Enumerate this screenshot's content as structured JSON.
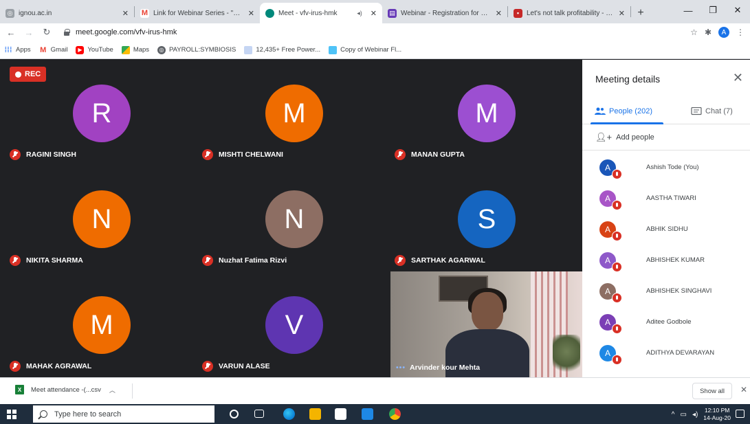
{
  "browser": {
    "tabs": [
      {
        "title": "ignou.ac.in",
        "favicon": "globe-icon",
        "active": false
      },
      {
        "title": "Link for Webinar Series - \"Can",
        "favicon": "gmail-icon",
        "active": false
      },
      {
        "title": "Meet - vfv-irus-hmk",
        "favicon": "meet-icon",
        "active": true
      },
      {
        "title": "Webinar - Registration for Gue",
        "favicon": "forms-icon",
        "active": false
      },
      {
        "title": "Let's not talk profitability - Ch",
        "favicon": "video-icon",
        "active": false
      }
    ],
    "url": "meet.google.com/vfv-irus-hmk",
    "profile_initial": "A",
    "bookmarks": [
      {
        "label": "Apps",
        "icon": "apps-grid-icon",
        "color": "#4285f4"
      },
      {
        "label": "Gmail",
        "icon": "gmail-icon",
        "color": "#ea4335"
      },
      {
        "label": "YouTube",
        "icon": "youtube-icon",
        "color": "#ff0000"
      },
      {
        "label": "Maps",
        "icon": "maps-icon",
        "color": "#34a853"
      },
      {
        "label": "PAYROLL:SYMBIOSIS",
        "icon": "globe-icon",
        "color": "#5f6368"
      },
      {
        "label": "12,435+ Free Power...",
        "icon": "page-icon",
        "color": "#8ab4f8"
      },
      {
        "label": "Copy of Webinar Fl...",
        "icon": "page-icon",
        "color": "#4fc3f7"
      }
    ]
  },
  "meet": {
    "rec_label": "REC",
    "tiles": [
      {
        "initial": "R",
        "name": "RAGINI SINGH",
        "color": "#a142c2"
      },
      {
        "initial": "M",
        "name": "MISHTI CHELWANI",
        "color": "#ef6c00"
      },
      {
        "initial": "M",
        "name": "MANAN GUPTA",
        "color": "#9c4fd1"
      },
      {
        "initial": "N",
        "name": "NIKITA SHARMA",
        "color": "#ef6c00"
      },
      {
        "initial": "N",
        "name": "Nuzhat Fatima Rizvi",
        "color": "#8d6e63"
      },
      {
        "initial": "S",
        "name": "SARTHAK AGARWAL",
        "color": "#1565c0"
      },
      {
        "initial": "M",
        "name": "MAHAK AGRAWAL",
        "color": "#ef6c00"
      },
      {
        "initial": "V",
        "name": "VARUN ALASE",
        "color": "#5e35b1"
      }
    ],
    "presenter_name": "Arvinder kour Mehta",
    "presenter_dots": "•••"
  },
  "panel": {
    "title": "Meeting details",
    "people_tab": "People (202)",
    "chat_tab": "Chat (7)",
    "add_people": "Add people",
    "participants": [
      {
        "initial": "A",
        "name": "Ashish Tode (You)",
        "color": "#1a56b8"
      },
      {
        "initial": "A",
        "name": "AASTHA TIWARI",
        "color": "#a855c7"
      },
      {
        "initial": "A",
        "name": "ABHIK SIDHU",
        "color": "#d84315"
      },
      {
        "initial": "A",
        "name": "ABHISHEK KUMAR",
        "color": "#8e59c9"
      },
      {
        "initial": "A",
        "name": "ABHISHEK SINGHAVI",
        "color": "#8d6e63"
      },
      {
        "initial": "A",
        "name": "Aditee Godbole",
        "color": "#7b3fb5"
      },
      {
        "initial": "A",
        "name": "ADITHYA DEVARAYAN",
        "color": "#1e88e5"
      }
    ]
  },
  "downloads": {
    "file": "Meet attendance -(...csv",
    "show_all": "Show all"
  },
  "taskbar": {
    "search_placeholder": "Type here to search",
    "time": "12:10 PM",
    "date": "14-Aug-20"
  }
}
